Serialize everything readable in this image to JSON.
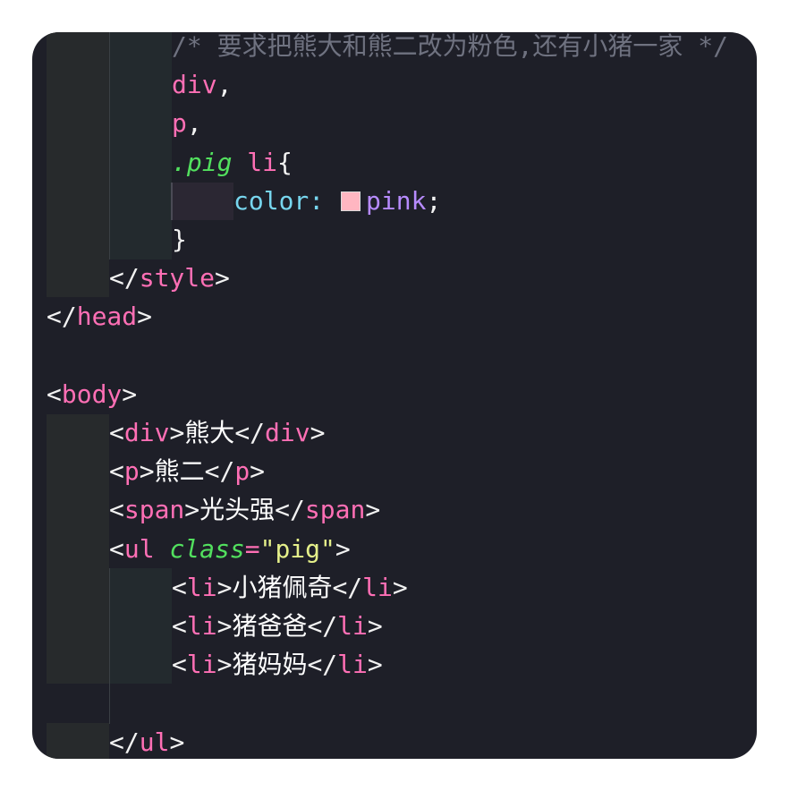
{
  "editor": {
    "lines": [
      {
        "indent": 2,
        "segments": [
          {
            "t": "/* 要求把熊大和熊二改为粉色,还有小猪一家 */",
            "k": "cmt"
          }
        ]
      },
      {
        "indent": 2,
        "segments": [
          {
            "t": "div",
            "k": "tag"
          },
          {
            "t": ",",
            "k": "punct"
          }
        ]
      },
      {
        "indent": 2,
        "segments": [
          {
            "t": "p",
            "k": "tag"
          },
          {
            "t": ",",
            "k": "punct"
          }
        ]
      },
      {
        "indent": 2,
        "segments": [
          {
            "t": ".pig",
            "k": "cls"
          },
          {
            "t": " ",
            "k": "punct"
          },
          {
            "t": "li",
            "k": "tag"
          },
          {
            "t": "{",
            "k": "punct"
          }
        ]
      },
      {
        "indent": 3,
        "segments": [
          {
            "t": "color",
            "k": "prop"
          },
          {
            "t": ": ",
            "k": "prop"
          },
          {
            "t": "",
            "k": "swatch"
          },
          {
            "t": "pink",
            "k": "val"
          },
          {
            "t": ";",
            "k": "punct"
          }
        ]
      },
      {
        "indent": 2,
        "segments": [
          {
            "t": "}",
            "k": "punct"
          }
        ]
      },
      {
        "indent": 1,
        "segments": [
          {
            "t": "</",
            "k": "punct"
          },
          {
            "t": "style",
            "k": "tag"
          },
          {
            "t": ">",
            "k": "punct"
          }
        ]
      },
      {
        "indent": 0,
        "segments": [
          {
            "t": "</",
            "k": "punct"
          },
          {
            "t": "head",
            "k": "tag"
          },
          {
            "t": ">",
            "k": "punct"
          }
        ]
      },
      {
        "indent": 0,
        "segments": []
      },
      {
        "indent": 0,
        "segments": [
          {
            "t": "<",
            "k": "punct"
          },
          {
            "t": "body",
            "k": "tag"
          },
          {
            "t": ">",
            "k": "punct"
          }
        ]
      },
      {
        "indent": 1,
        "segments": [
          {
            "t": "<",
            "k": "punct"
          },
          {
            "t": "div",
            "k": "tag"
          },
          {
            "t": ">",
            "k": "punct"
          },
          {
            "t": "熊大",
            "k": "txt"
          },
          {
            "t": "</",
            "k": "punct"
          },
          {
            "t": "div",
            "k": "tag"
          },
          {
            "t": ">",
            "k": "punct"
          }
        ]
      },
      {
        "indent": 1,
        "segments": [
          {
            "t": "<",
            "k": "punct"
          },
          {
            "t": "p",
            "k": "tag"
          },
          {
            "t": ">",
            "k": "punct"
          },
          {
            "t": "熊二",
            "k": "txt"
          },
          {
            "t": "</",
            "k": "punct"
          },
          {
            "t": "p",
            "k": "tag"
          },
          {
            "t": ">",
            "k": "punct"
          }
        ]
      },
      {
        "indent": 1,
        "segments": [
          {
            "t": "<",
            "k": "punct"
          },
          {
            "t": "span",
            "k": "tag"
          },
          {
            "t": ">",
            "k": "punct"
          },
          {
            "t": "光头强",
            "k": "txt"
          },
          {
            "t": "</",
            "k": "punct"
          },
          {
            "t": "span",
            "k": "tag"
          },
          {
            "t": ">",
            "k": "punct"
          }
        ]
      },
      {
        "indent": 1,
        "segments": [
          {
            "t": "<",
            "k": "punct"
          },
          {
            "t": "ul",
            "k": "tag"
          },
          {
            "t": " ",
            "k": "punct"
          },
          {
            "t": "class",
            "k": "cls"
          },
          {
            "t": "=",
            "k": "tag"
          },
          {
            "t": "\"pig\"",
            "k": "str"
          },
          {
            "t": ">",
            "k": "punct"
          }
        ]
      },
      {
        "indent": 2,
        "segments": [
          {
            "t": "<",
            "k": "punct"
          },
          {
            "t": "li",
            "k": "tag"
          },
          {
            "t": ">",
            "k": "punct"
          },
          {
            "t": "小猪佩奇",
            "k": "txt"
          },
          {
            "t": "</",
            "k": "punct"
          },
          {
            "t": "li",
            "k": "tag"
          },
          {
            "t": ">",
            "k": "punct"
          }
        ]
      },
      {
        "indent": 2,
        "segments": [
          {
            "t": "<",
            "k": "punct"
          },
          {
            "t": "li",
            "k": "tag"
          },
          {
            "t": ">",
            "k": "punct"
          },
          {
            "t": "猪爸爸",
            "k": "txt"
          },
          {
            "t": "</",
            "k": "punct"
          },
          {
            "t": "li",
            "k": "tag"
          },
          {
            "t": ">",
            "k": "punct"
          }
        ]
      },
      {
        "indent": 2,
        "segments": [
          {
            "t": "<",
            "k": "punct"
          },
          {
            "t": "li",
            "k": "tag"
          },
          {
            "t": ">",
            "k": "punct"
          },
          {
            "t": "猪妈妈",
            "k": "txt"
          },
          {
            "t": "</",
            "k": "punct"
          },
          {
            "t": "li",
            "k": "tag"
          },
          {
            "t": ">",
            "k": "punct"
          }
        ]
      },
      {
        "indent": 0,
        "segments": []
      },
      {
        "indent": 1,
        "segments": [
          {
            "t": "</",
            "k": "punct"
          },
          {
            "t": "ul",
            "k": "tag"
          },
          {
            "t": ">",
            "k": "punct"
          }
        ]
      }
    ],
    "swatch_color": "#ffb6c1",
    "colors": {
      "background": "#1e1f28",
      "comment": "#6f7280",
      "tag": "#ff6fb5",
      "class": "#52e05e",
      "property": "#77d6ee",
      "value": "#b78bff",
      "string": "#e5f08a",
      "text": "#ffffff"
    }
  }
}
